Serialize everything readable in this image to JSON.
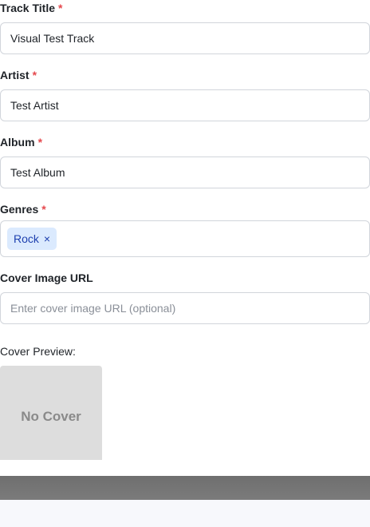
{
  "form": {
    "track_title": {
      "label": "Track Title",
      "required_mark": "*",
      "value": "Visual Test Track"
    },
    "artist": {
      "label": "Artist",
      "required_mark": "*",
      "value": "Test Artist"
    },
    "album": {
      "label": "Album",
      "required_mark": "*",
      "value": "Test Album"
    },
    "genres": {
      "label": "Genres",
      "required_mark": "*",
      "selected": [
        {
          "label": "Rock",
          "remove_glyph": "×"
        }
      ]
    },
    "cover_url": {
      "label": "Cover Image URL",
      "value": "",
      "placeholder": "Enter cover image URL (optional)"
    },
    "cover_preview": {
      "label": "Cover Preview:",
      "placeholder_text": "No Cover"
    }
  },
  "colors": {
    "required": "#e5484d",
    "chip_bg": "#dbeafe",
    "chip_text": "#1e40af",
    "input_border": "#d1d5db",
    "cover_bg": "#dddddd"
  },
  "icons": {
    "chip_remove": "close-icon"
  }
}
